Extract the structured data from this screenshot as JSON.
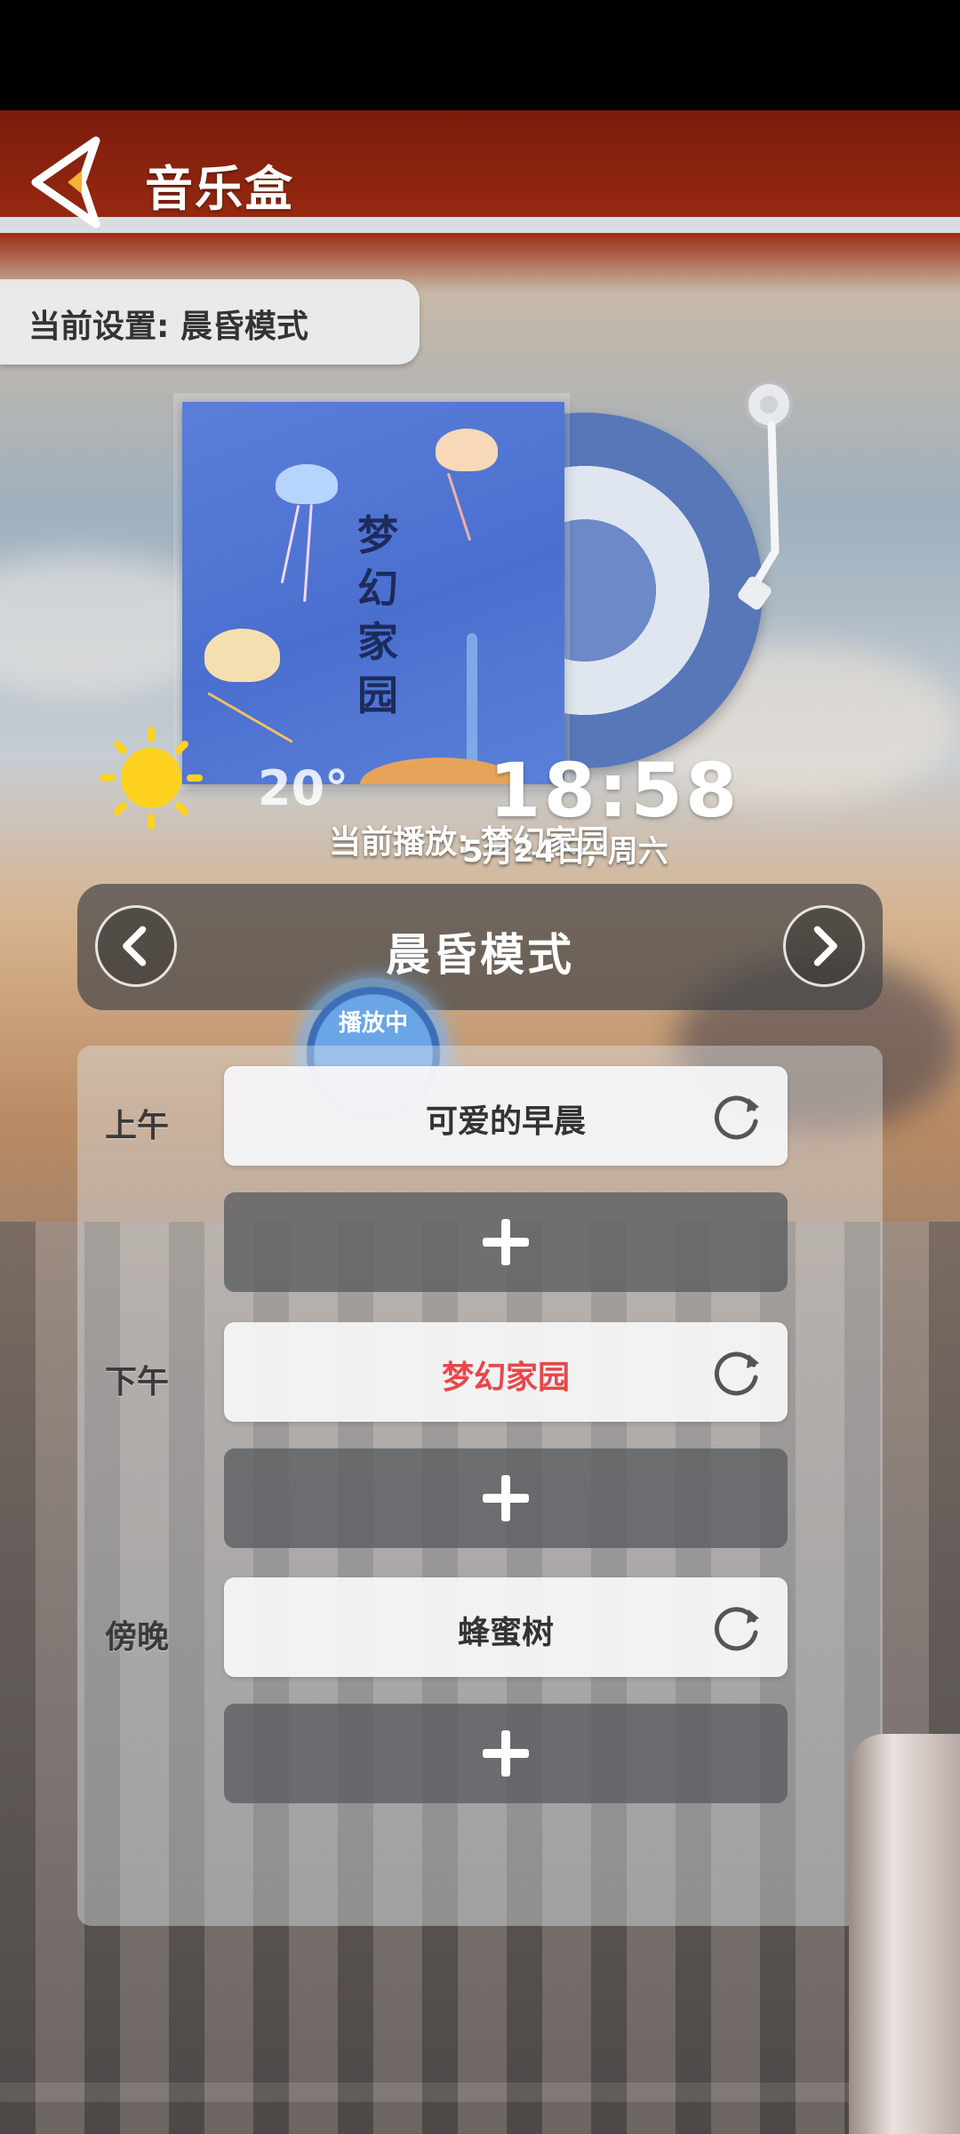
{
  "header": {
    "title": "音乐盒"
  },
  "current_setting": {
    "label": "当前设置: 晨昏模式"
  },
  "album": {
    "cover_text": "梦幻家园"
  },
  "widget": {
    "temperature": "20°",
    "clock": "18:58",
    "now_playing": "当前播放: 梦幻家园",
    "date": "5月24日, 周六",
    "playing_badge": "播放中"
  },
  "mode": {
    "label": "晨昏模式"
  },
  "schedule": [
    {
      "time_label": "上午",
      "song": "可爱的早晨",
      "color": "#333333"
    },
    {
      "time_label": "下午",
      "song": "梦幻家园",
      "color": "#e8474a"
    },
    {
      "time_label": "傍晚",
      "song": "蜂蜜树",
      "color": "#333333"
    }
  ],
  "colors": {
    "accent_playing": "#e8474a"
  }
}
